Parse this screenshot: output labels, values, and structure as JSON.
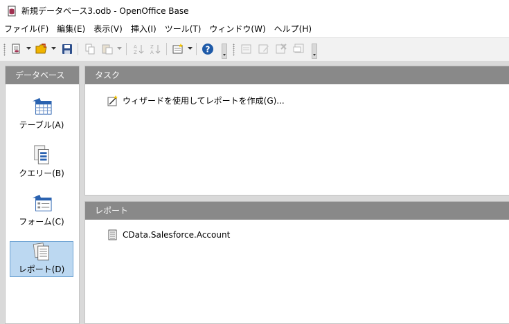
{
  "window": {
    "title": "新規データベース3.odb - OpenOffice Base"
  },
  "menu": [
    {
      "label": "ファイル(F)"
    },
    {
      "label": "編集(E)"
    },
    {
      "label": "表示(V)"
    },
    {
      "label": "挿入(I)"
    },
    {
      "label": "ツール(T)"
    },
    {
      "label": "ウィンドウ(W)"
    },
    {
      "label": "ヘルプ(H)"
    }
  ],
  "toolbar": {
    "icons": [
      "new-document-icon",
      "open-folder-icon",
      "save-icon",
      "copy-icon",
      "paste-icon",
      "sort-ascending-icon",
      "sort-descending-icon",
      "form-wizard-icon",
      "help-icon",
      "open-object-icon",
      "edit-icon",
      "delete-icon",
      "rename-icon"
    ]
  },
  "database_panel": {
    "header": "データベース",
    "items": [
      {
        "label": "テーブル(A)",
        "icon": "table-icon",
        "selected": false
      },
      {
        "label": "クエリー(B)",
        "icon": "query-icon",
        "selected": false
      },
      {
        "label": "フォーム(C)",
        "icon": "form-icon",
        "selected": false
      },
      {
        "label": "レポート(D)",
        "icon": "report-icon",
        "selected": true
      }
    ]
  },
  "tasks_panel": {
    "header": "タスク",
    "items": [
      {
        "label": "ウィザードを使用してレポートを作成(G)...",
        "icon": "wizard-icon"
      }
    ]
  },
  "reports_panel": {
    "header": "レポート",
    "items": [
      {
        "label": "CData.Salesforce.Account",
        "icon": "report-document-icon"
      }
    ]
  },
  "colors": {
    "panel_header": "#898989",
    "selection": "#bcd8f1",
    "background": "#d9d9d9",
    "help_blue": "#1e5aa8"
  }
}
